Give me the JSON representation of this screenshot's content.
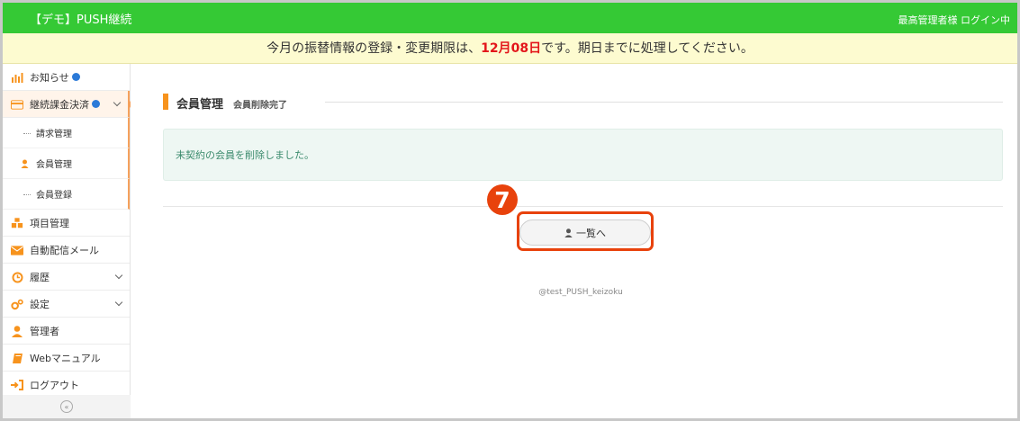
{
  "header": {
    "app_title": "【デモ】PUSH継続",
    "user_status": "最高管理者様 ログイン中"
  },
  "notice": {
    "prefix": "今月の振替情報の登録・変更期限は、",
    "deadline": "12月08日",
    "suffix": "です。期日までに処理してください。"
  },
  "sidebar": {
    "items": [
      {
        "label": "お知らせ",
        "icon": "bar-chart-icon"
      },
      {
        "label": "継続課金決済",
        "icon": "credit-card-icon"
      },
      {
        "label": "項目管理",
        "icon": "cubes-icon"
      },
      {
        "label": "自動配信メール",
        "icon": "envelope-icon"
      },
      {
        "label": "履歴",
        "icon": "history-icon"
      },
      {
        "label": "設定",
        "icon": "gears-icon"
      },
      {
        "label": "管理者",
        "icon": "user-icon"
      },
      {
        "label": "Webマニュアル",
        "icon": "book-icon"
      },
      {
        "label": "ログアウト",
        "icon": "sign-out-icon"
      }
    ],
    "subitems": [
      {
        "label": "請求管理"
      },
      {
        "label": "会員管理"
      },
      {
        "label": "会員登録"
      }
    ],
    "collapse_label": "«"
  },
  "main": {
    "title": "会員管理",
    "subtitle": "会員削除完了",
    "message": "未契約の会員を削除しました。",
    "step_number": "7",
    "list_button": "一覧へ",
    "footer": "@test_PUSH_keizoku"
  },
  "colors": {
    "topbar": "#35c935",
    "notice_bg": "#fdfbd0",
    "deadline": "#e3161b",
    "accent": "#f7931d",
    "highlight": "#e8420c",
    "alert_bg": "#eef7f3",
    "alert_text": "#3a8a6c"
  }
}
